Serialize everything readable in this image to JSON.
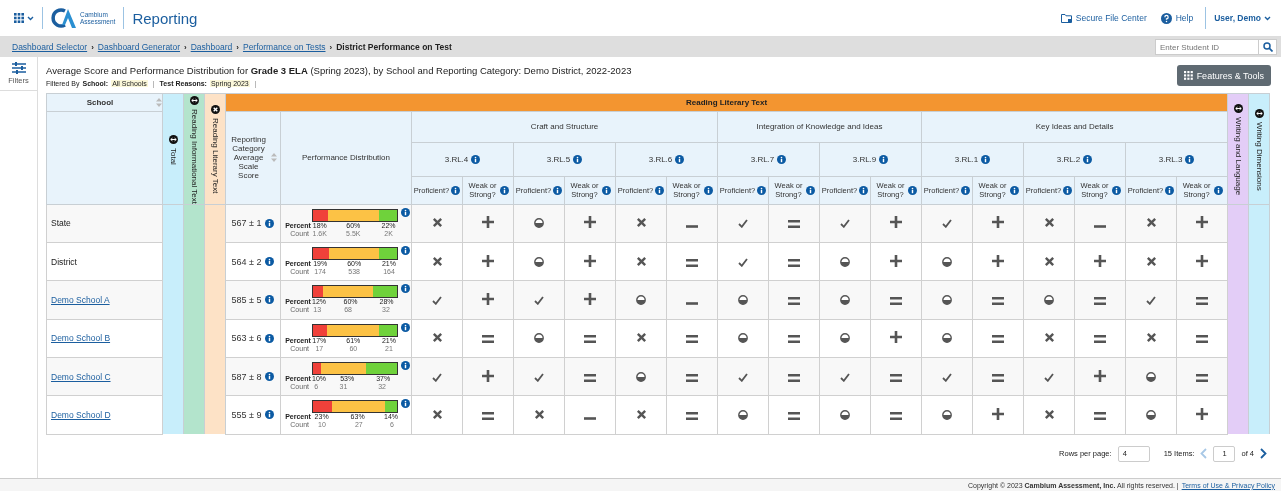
{
  "topbar": {
    "logo_lines": [
      "Cambium",
      "Assessment"
    ],
    "app_title": "Reporting",
    "links": [
      {
        "kind": "folder",
        "label": "Secure File Center"
      },
      {
        "kind": "help",
        "label": "Help"
      }
    ],
    "user": "User, Demo"
  },
  "breadcrumbs": [
    {
      "label": "Dashboard Selector",
      "link": true
    },
    {
      "separator": "›",
      "label": "Dashboard Generator",
      "link": true
    },
    {
      "separator": "›",
      "label": "Dashboard",
      "link": true
    },
    {
      "separator": "›",
      "label": "Performance on Tests",
      "link": true
    },
    {
      "separator": "›",
      "label": "District Performance on Test",
      "link": false
    }
  ],
  "student_search": {
    "placeholder": "Enter Student ID"
  },
  "sidebar": {
    "filters_label": "Filters"
  },
  "report": {
    "title": "Average Score and Performance Distribution for **Grade 3 ELA** (Spring 2023), by School and Reporting Category: Demo District, 2022-2023",
    "filtered_by": "Filtered By",
    "filters": [
      {
        "label": "School:",
        "value": "All Schools",
        "separator": "|"
      },
      {
        "label": "Test Reasons:",
        "value": "Spring 2023",
        "separator": "|"
      }
    ],
    "tools_button": "Features & Tools"
  },
  "table": {
    "school_header": "School",
    "left_categories": [
      {
        "label": "Total",
        "expanded": false,
        "color": "#c8eefb"
      },
      {
        "label": "Reading Informational Text",
        "expanded": false,
        "color": "#b3e4cc"
      },
      {
        "label": "Reading Literary Text",
        "expanded": true,
        "color": "#fde2c6"
      }
    ],
    "expanded_category": {
      "label": "Reading Literary Text",
      "score_header": "Reporting Category Average Scale Score",
      "distribution_header": "Performance Distribution",
      "groups": [
        {
          "label": "Craft and Structure",
          "standards": [
            {
              "label": "3.RL.4",
              "columns": [
                "Proficient?",
                "Weak or Strong?"
              ]
            },
            {
              "label": "3.RL.5",
              "columns": [
                "Proficient?",
                "Weak or Strong?"
              ]
            },
            {
              "label": "3.RL.6",
              "columns": [
                "Proficient?",
                "Weak or Strong?"
              ]
            }
          ]
        },
        {
          "label": "Integration of Knowledge and Ideas",
          "standards": [
            {
              "label": "3.RL.7",
              "columns": [
                "Proficient?",
                "Weak or Strong?"
              ]
            },
            {
              "label": "3.RL.9",
              "columns": [
                "Proficient?",
                "Weak or Strong?"
              ]
            }
          ]
        },
        {
          "label": "Key Ideas and Details",
          "standards": [
            {
              "label": "3.RL.1",
              "columns": [
                "Proficient?",
                "Weak or Strong?"
              ]
            },
            {
              "label": "3.RL.2",
              "columns": [
                "Proficient?",
                "Weak or Strong?"
              ]
            },
            {
              "label": "3.RL.3",
              "columns": [
                "Proficient?",
                "Weak or Strong?"
              ]
            }
          ]
        }
      ]
    },
    "right_categories": [
      {
        "label": "Writing and Language",
        "expanded": false,
        "color": "#e3cdf7"
      },
      {
        "label": "Writing Dimensions",
        "expanded": false,
        "color": "#c8eefb"
      }
    ],
    "rows": [
      {
        "school": "State",
        "link": false,
        "score": "567 ± 1",
        "distribution": {
          "percent_label": "Percent",
          "count_label": "Count",
          "segments": [
            {
              "level": 0.18,
              "percent": "18%",
              "count": "1.6K"
            },
            {
              "percent": "60%",
              "count": "5.5K"
            },
            {
              "level": 0.22,
              "percent": "22%",
              "count": "2K"
            }
          ]
        },
        "marks": [
          {
            "kind": "cross"
          },
          {
            "kind": "plus"
          },
          {
            "kind": "half"
          },
          {
            "kind": "plus"
          },
          {
            "kind": "cross"
          },
          {
            "kind": "minus"
          },
          {
            "kind": "check"
          },
          {
            "kind": "equal"
          },
          {
            "kind": "check"
          },
          {
            "kind": "plus"
          },
          {
            "kind": "check"
          },
          {
            "kind": "plus"
          },
          {
            "kind": "cross"
          },
          {
            "kind": "minus"
          },
          {
            "kind": "cross"
          },
          {
            "kind": "plus"
          }
        ]
      },
      {
        "school": "District",
        "link": false,
        "score": "564 ± 2",
        "distribution": {
          "percent_label": "Percent",
          "count_label": "Count",
          "segments": [
            {
              "level": 0.19,
              "percent": "19%",
              "count": "174"
            },
            {
              "percent": "60%",
              "count": "538"
            },
            {
              "level": 0.21,
              "percent": "21%",
              "count": "164"
            }
          ]
        },
        "marks": [
          {
            "kind": "cross"
          },
          {
            "kind": "plus"
          },
          {
            "kind": "half"
          },
          {
            "kind": "plus"
          },
          {
            "kind": "cross"
          },
          {
            "kind": "equal"
          },
          {
            "kind": "check"
          },
          {
            "kind": "equal"
          },
          {
            "kind": "half"
          },
          {
            "kind": "plus"
          },
          {
            "kind": "half"
          },
          {
            "kind": "plus"
          },
          {
            "kind": "cross"
          },
          {
            "kind": "plus"
          },
          {
            "kind": "cross"
          },
          {
            "kind": "plus"
          }
        ]
      },
      {
        "school": "Demo School A",
        "link": true,
        "score": "585 ± 5",
        "distribution": {
          "percent_label": "Percent",
          "count_label": "Count",
          "segments": [
            {
              "level": 0.12,
              "percent": "12%",
              "count": "13"
            },
            {
              "percent": "60%",
              "count": "68"
            },
            {
              "level": 0.28,
              "percent": "28%",
              "count": "32"
            }
          ]
        },
        "marks": [
          {
            "kind": "check"
          },
          {
            "kind": "plus"
          },
          {
            "kind": "check"
          },
          {
            "kind": "plus"
          },
          {
            "kind": "half"
          },
          {
            "kind": "minus"
          },
          {
            "kind": "half"
          },
          {
            "kind": "equal"
          },
          {
            "kind": "half"
          },
          {
            "kind": "equal"
          },
          {
            "kind": "half"
          },
          {
            "kind": "equal"
          },
          {
            "kind": "half"
          },
          {
            "kind": "equal"
          },
          {
            "kind": "check"
          },
          {
            "kind": "equal"
          }
        ]
      },
      {
        "school": "Demo School B",
        "link": true,
        "score": "563 ± 6",
        "distribution": {
          "percent_label": "Percent",
          "count_label": "Count",
          "segments": [
            {
              "level": 0.17,
              "percent": "17%",
              "count": "17"
            },
            {
              "percent": "61%",
              "count": "60"
            },
            {
              "level": 0.21,
              "percent": "21%",
              "count": "21"
            }
          ]
        },
        "marks": [
          {
            "kind": "cross"
          },
          {
            "kind": "equal"
          },
          {
            "kind": "half"
          },
          {
            "kind": "equal"
          },
          {
            "kind": "cross"
          },
          {
            "kind": "equal"
          },
          {
            "kind": "half"
          },
          {
            "kind": "equal"
          },
          {
            "kind": "half"
          },
          {
            "kind": "plus"
          },
          {
            "kind": "half"
          },
          {
            "kind": "equal"
          },
          {
            "kind": "cross"
          },
          {
            "kind": "equal"
          },
          {
            "kind": "cross"
          },
          {
            "kind": "equal"
          }
        ]
      },
      {
        "school": "Demo School C",
        "link": true,
        "score": "587 ± 8",
        "distribution": {
          "percent_label": "Percent",
          "count_label": "Count",
          "segments": [
            {
              "level": 0.1,
              "percent": "10%",
              "count": "6"
            },
            {
              "percent": "53%",
              "count": "31"
            },
            {
              "level": 0.37,
              "percent": "37%",
              "count": "32"
            }
          ]
        },
        "marks": [
          {
            "kind": "check"
          },
          {
            "kind": "plus"
          },
          {
            "kind": "check"
          },
          {
            "kind": "equal"
          },
          {
            "kind": "half"
          },
          {
            "kind": "equal"
          },
          {
            "kind": "check"
          },
          {
            "kind": "equal"
          },
          {
            "kind": "check"
          },
          {
            "kind": "equal"
          },
          {
            "kind": "check"
          },
          {
            "kind": "equal"
          },
          {
            "kind": "check"
          },
          {
            "kind": "plus"
          },
          {
            "kind": "half"
          },
          {
            "kind": "equal"
          }
        ]
      },
      {
        "school": "Demo School D",
        "link": true,
        "score": "555 ± 9",
        "distribution": {
          "percent_label": "Percent",
          "count_label": "Count",
          "segments": [
            {
              "level": 0.23,
              "percent": "23%",
              "count": "10"
            },
            {
              "percent": "63%",
              "count": "27"
            },
            {
              "level": 0.14,
              "percent": "14%",
              "count": "6"
            }
          ]
        },
        "marks": [
          {
            "kind": "cross"
          },
          {
            "kind": "equal"
          },
          {
            "kind": "cross"
          },
          {
            "kind": "minus"
          },
          {
            "kind": "cross"
          },
          {
            "kind": "equal"
          },
          {
            "kind": "half"
          },
          {
            "kind": "equal"
          },
          {
            "kind": "half"
          },
          {
            "kind": "equal"
          },
          {
            "kind": "half"
          },
          {
            "kind": "plus"
          },
          {
            "kind": "cross"
          },
          {
            "kind": "equal"
          },
          {
            "kind": "half"
          },
          {
            "kind": "plus"
          }
        ]
      }
    ]
  },
  "pagination": {
    "rows_per_page_label": "Rows per page:",
    "rows_per_page": "4",
    "items": "15 Items:",
    "page": "1",
    "page_count": "of 4",
    "prev_disabled": true,
    "next_disabled": false
  },
  "footer": {
    "copyright": "Copyright © 2023 **Cambium Assessment, Inc.** All rights reserved. |",
    "link": "Terms of Use & Privacy Policy"
  }
}
